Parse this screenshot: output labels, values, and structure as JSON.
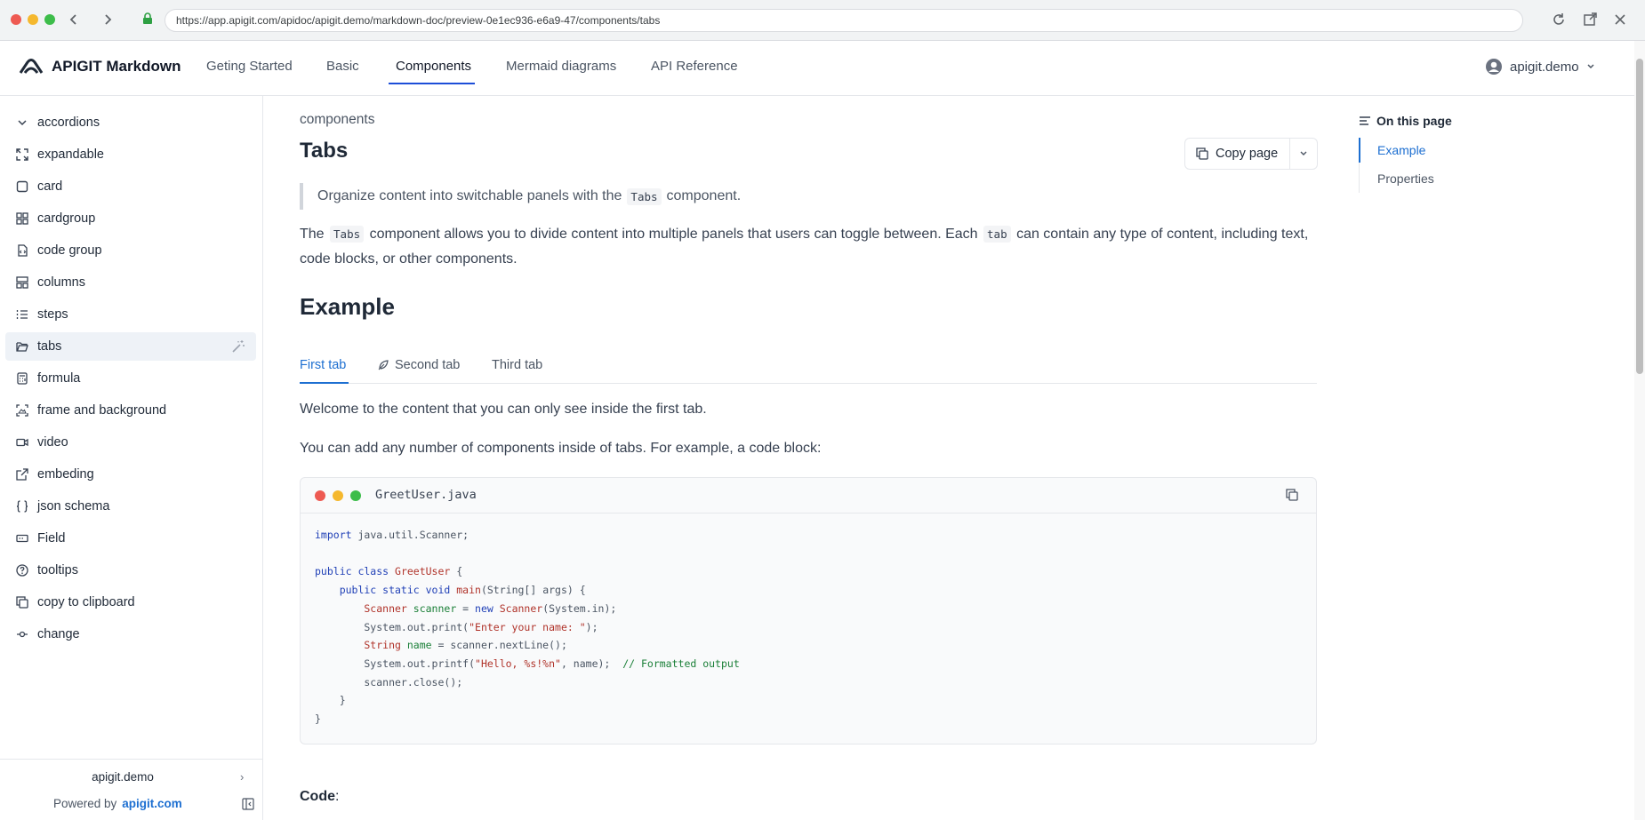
{
  "browser": {
    "url": "https://app.apigit.com/apidoc/apigit.demo/markdown-doc/preview-0e1ec936-e6a9-47/components/tabs"
  },
  "header": {
    "brand": "APIGIT Markdown",
    "nav": [
      "Geting Started",
      "Basic",
      "Components",
      "Mermaid diagrams",
      "API Reference"
    ],
    "active_nav": "Components",
    "user": "apigit.demo"
  },
  "sidebar": {
    "items": [
      {
        "label": "accordions",
        "icon": "chevron-down-icon"
      },
      {
        "label": "expandable",
        "icon": "expand-icon"
      },
      {
        "label": "card",
        "icon": "card-icon"
      },
      {
        "label": "cardgroup",
        "icon": "grid-icon"
      },
      {
        "label": "code group",
        "icon": "code-file-icon"
      },
      {
        "label": "columns",
        "icon": "columns-icon"
      },
      {
        "label": "steps",
        "icon": "list-icon"
      },
      {
        "label": "tabs",
        "icon": "folder-open-icon"
      },
      {
        "label": "formula",
        "icon": "calculator-icon"
      },
      {
        "label": "frame and background",
        "icon": "image-frame-icon"
      },
      {
        "label": "video",
        "icon": "video-icon"
      },
      {
        "label": "embeding",
        "icon": "external-link-icon"
      },
      {
        "label": "json schema",
        "icon": "braces-icon"
      },
      {
        "label": "Field",
        "icon": "field-icon"
      },
      {
        "label": "tooltips",
        "icon": "help-circle-icon"
      },
      {
        "label": "copy to clipboard",
        "icon": "copy-icon"
      },
      {
        "label": "change",
        "icon": "commit-icon"
      }
    ],
    "active": "tabs",
    "footer_name": "apigit.demo",
    "powered_by": "Powered by",
    "powered_link": "apigit.com"
  },
  "main": {
    "breadcrumb": "components",
    "title": "Tabs",
    "copy_button": "Copy page",
    "quote_pre": "Organize content into switchable panels with the",
    "quote_code": "Tabs",
    "quote_post": "component.",
    "intro": {
      "p1": "The",
      "c1": "Tabs",
      "p2": "component allows you to divide content into multiple panels that users can toggle between. Each",
      "c2": "tab",
      "p3": "can contain any type of content, including text,",
      "p4": "code blocks, or other components."
    },
    "section_title": "Example",
    "tabs": [
      "First tab",
      "Second tab",
      "Third tab"
    ],
    "active_tab": "First tab",
    "tab_text1": "Welcome to the content that you can only see inside the first tab.",
    "tab_text2": "You can add any number of components inside of tabs. For example, a code block:",
    "code_filename": "GreetUser.java",
    "code_label": "Code",
    "code_colon": ":"
  },
  "toc": {
    "heading": "On this page",
    "items": [
      "Example",
      "Properties"
    ],
    "active": "Example"
  },
  "colors": {
    "accent": "#1d6fd1",
    "traffic_red": "#ee5a52",
    "traffic_yellow": "#f5b82e",
    "traffic_green": "#3dbd4a"
  }
}
